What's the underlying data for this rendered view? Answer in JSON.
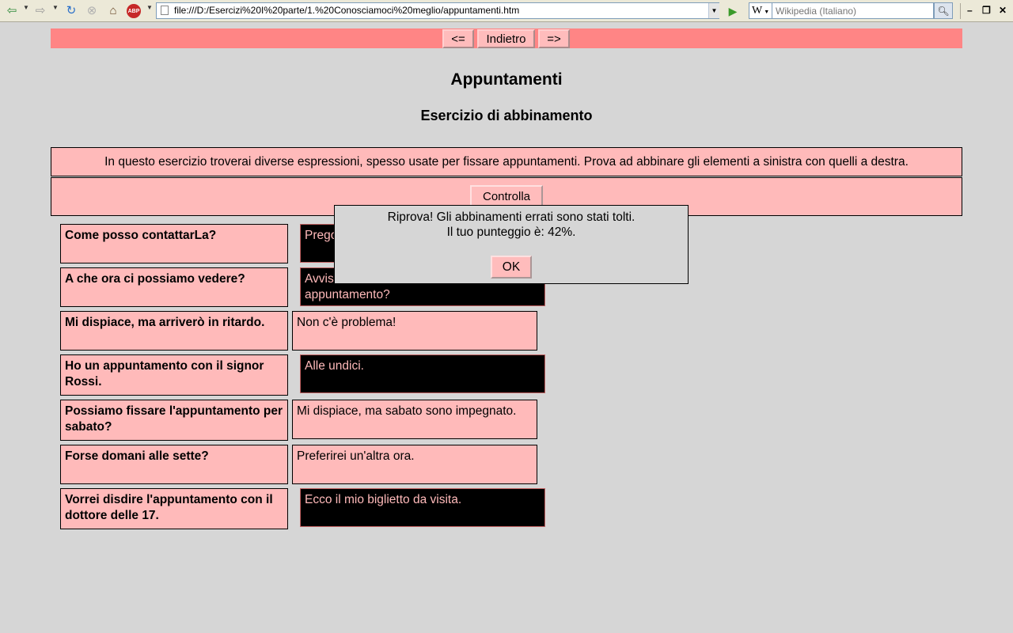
{
  "browser": {
    "url": "file:///D:/Esercizi%20I%20parte/1.%20Conosciamoci%20meglio/appuntamenti.htm",
    "search_engine_label": "W",
    "search_placeholder": "Wikipedia (Italiano)",
    "adblock_label": "ABP"
  },
  "nav": {
    "prev_label": "<=",
    "back_label": "Indietro",
    "next_label": "=>"
  },
  "page": {
    "title": "Appuntamenti",
    "subtitle": "Esercizio di abbinamento",
    "instructions": "In questo esercizio troverai diverse espressioni, spesso usate per fissare appuntamenti. Prova ad abbinare gli elementi a sinistra con quelli a destra.",
    "check_label": "Controlla"
  },
  "pairs": [
    {
      "left": "Come posso contattarLa?",
      "right": "Prego...",
      "right_style": "dark"
    },
    {
      "left": "A che ora ci possiamo vedere?",
      "right": "Avvisi... un appuntamento?",
      "right_style": "dark"
    },
    {
      "left": "Mi dispiace, ma arriverò in ritardo.",
      "right": "Non c'è problema!",
      "right_style": "light"
    },
    {
      "left": "Ho un appuntamento con il signor Rossi.",
      "right": "Alle undici.",
      "right_style": "dark"
    },
    {
      "left": "Possiamo fissare l'appuntamento per sabato?",
      "right": "Mi dispiace, ma sabato sono impegnato.",
      "right_style": "light"
    },
    {
      "left": "Forse domani alle sette?",
      "right": "Preferirei un'altra ora.",
      "right_style": "light"
    },
    {
      "left": "Vorrei disdire l'appuntamento con il dottore delle 17.",
      "right": "Ecco il mio biglietto da visita.",
      "right_style": "dark"
    }
  ],
  "pair_display": {
    "right_1": "Prego",
    "right_2_line1": "Avvis",
    "right_2_line2": "appuntamento?"
  },
  "alert": {
    "line1": "Riprova! Gli abbinamenti errati sono stati tolti.",
    "line2": "Il tuo punteggio è: 42%.",
    "ok_label": "OK",
    "score_percent": 42
  },
  "colors": {
    "nav_bar": "#ff8585",
    "panel": "#ffbaba",
    "dark_item": "#000000",
    "page_bg": "#d6d6d6"
  }
}
